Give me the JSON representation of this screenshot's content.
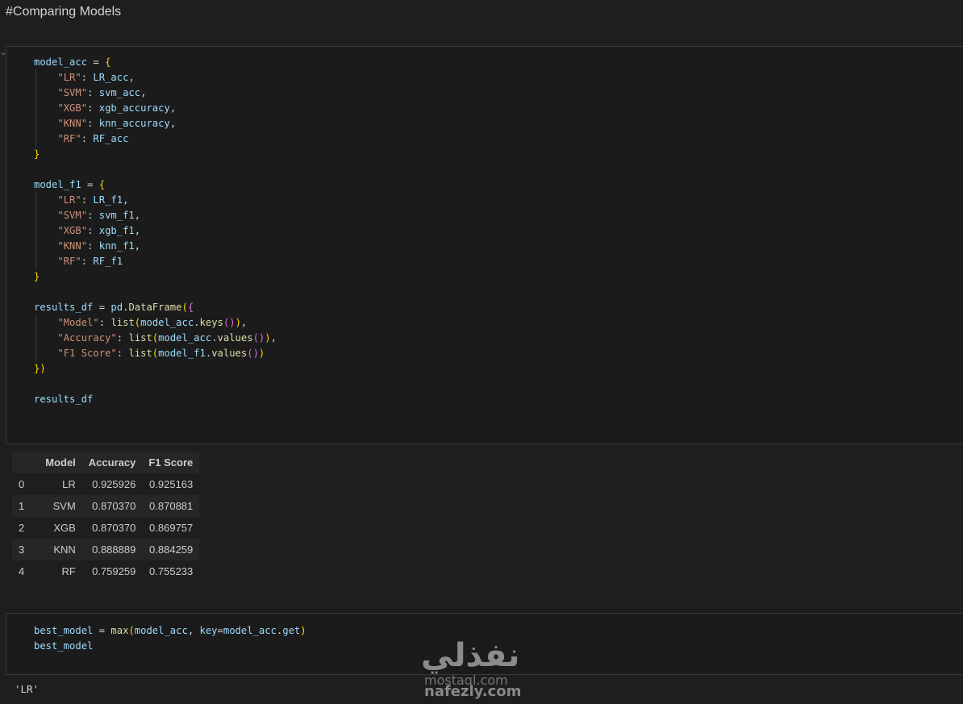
{
  "markdown": {
    "title": "#Comparing Models"
  },
  "cell1": {
    "code": [
      "model_acc = {",
      "    \"LR\": LR_acc,",
      "    \"SVM\": svm_acc,",
      "    \"XGB\": xgb_accuracy,",
      "    \"KNN\": knn_accuracy,",
      "    \"RF\": RF_acc",
      "}",
      "",
      "model_f1 = {",
      "    \"LR\": LR_f1,",
      "    \"SVM\": svm_f1,",
      "    \"XGB\": xgb_f1,",
      "    \"KNN\": knn_f1,",
      "    \"RF\": RF_f1",
      "}",
      "",
      "results_df = pd.DataFrame({",
      "    \"Model\": list(model_acc.keys()),",
      "    \"Accuracy\": list(model_acc.values()),",
      "    \"F1 Score\": list(model_f1.values())",
      "})",
      "",
      "results_df"
    ]
  },
  "dataframe": {
    "columns": [
      "",
      "Model",
      "Accuracy",
      "F1 Score"
    ],
    "rows": [
      [
        "0",
        "LR",
        "0.925926",
        "0.925163"
      ],
      [
        "1",
        "SVM",
        "0.870370",
        "0.870881"
      ],
      [
        "2",
        "XGB",
        "0.870370",
        "0.869757"
      ],
      [
        "3",
        "KNN",
        "0.888889",
        "0.884259"
      ],
      [
        "4",
        "RF",
        "0.759259",
        "0.755233"
      ]
    ]
  },
  "cell2": {
    "code": [
      "best_model = max(model_acc, key=model_acc.get)",
      "best_model"
    ],
    "output": "'LR'"
  },
  "watermark": {
    "logo_text": "نفذلي",
    "url_faded": "mostaql.com",
    "url": "nafezly.com"
  },
  "colors": {
    "variable": "#9cdcfe",
    "string": "#ce9178",
    "function": "#dcdcaa",
    "bracket_level1": "#ffd700",
    "bracket_level2": "#da70d6",
    "bracket_level3": "#179fff"
  }
}
